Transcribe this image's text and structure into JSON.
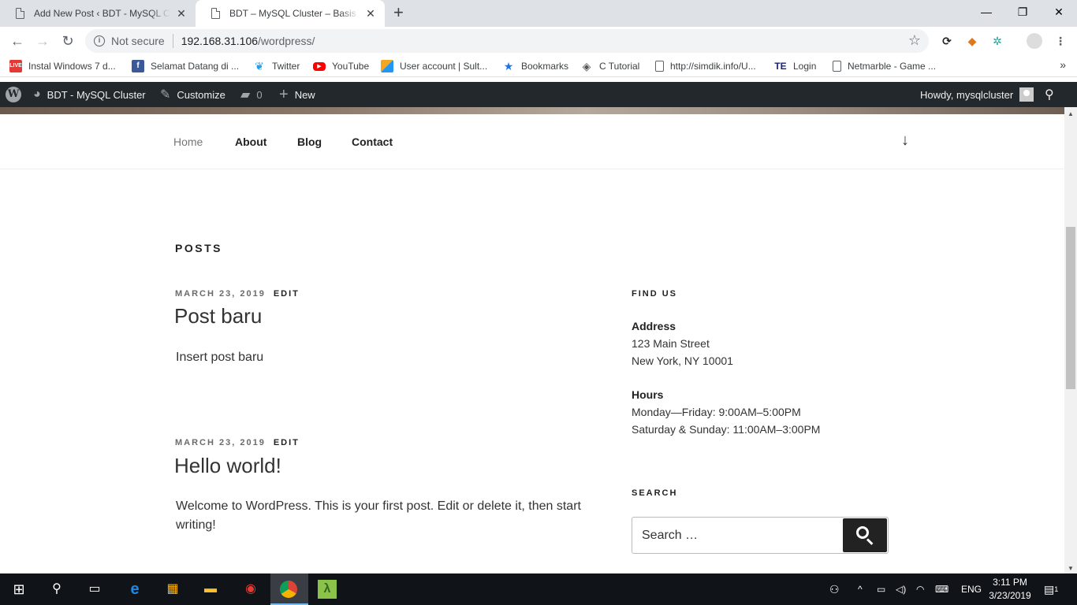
{
  "browser": {
    "tabs": [
      {
        "title": "Add New Post ‹ BDT - MySQL Cluster — WordPress",
        "close": "✕"
      },
      {
        "title": "BDT – MySQL Cluster – Basis Data Terdistribusi",
        "close": "✕"
      }
    ],
    "new_tab": "+",
    "window": {
      "minimize": "—",
      "maximize": "❐",
      "close": "✕"
    },
    "nav": {
      "back": "←",
      "forward": "→",
      "reload": "↻"
    },
    "security_label": "Not secure",
    "url_host": "192.168.31.106",
    "url_path": "/wordpress/",
    "bookmark_star": "☆",
    "bookmarks": [
      {
        "label": "Instal Windows 7 d...",
        "icon": "live-icon",
        "color": "#e53935"
      },
      {
        "label": "Selamat Datang di ...",
        "icon": "facebook-icon",
        "color": "#3b5998"
      },
      {
        "label": "Twitter",
        "icon": "twitter-icon",
        "color": "#1da1f2"
      },
      {
        "label": "YouTube",
        "icon": "youtube-icon",
        "color": "#ff0000"
      },
      {
        "label": "User account | Sult...",
        "icon": "sultan-icon",
        "color": "#f4a623"
      },
      {
        "label": "Bookmarks",
        "icon": "star-icon",
        "color": "#1a73e8"
      },
      {
        "label": "C Tutorial",
        "icon": "ctutorial-icon",
        "color": "#555555"
      },
      {
        "label": "http://simdik.info/U...",
        "icon": "doc-icon",
        "color": "#5f6368"
      },
      {
        "label": "Login",
        "icon": "te-icon",
        "color": "#1a237e"
      },
      {
        "label": "Netmarble - Game ...",
        "icon": "doc-icon",
        "color": "#5f6368"
      }
    ],
    "bookmarks_more": "»"
  },
  "adminbar": {
    "site_name": "BDT - MySQL Cluster",
    "customize": "Customize",
    "comments_count": "0",
    "new_label": "New",
    "howdy": "Howdy, mysqlcluster"
  },
  "nav": {
    "items": [
      "Home",
      "About",
      "Blog",
      "Contact"
    ],
    "scroll_arrow": "↓"
  },
  "main": {
    "section_title": "POSTS",
    "posts": [
      {
        "date": "MARCH 23, 2019",
        "edit": "EDIT",
        "title": "Post baru",
        "body": "Insert post baru"
      },
      {
        "date": "MARCH 23, 2019",
        "edit": "EDIT",
        "title": "Hello world!",
        "body": "Welcome to WordPress. This is your first post. Edit or delete it, then start writing!"
      }
    ]
  },
  "sidebar": {
    "find_us_title": "FIND US",
    "address_label": "Address",
    "address_line1": "123 Main Street",
    "address_line2": "New York, NY 10001",
    "hours_label": "Hours",
    "hours_line1": "Monday—Friday: 9:00AM–5:00PM",
    "hours_line2": "Saturday & Sunday: 11:00AM–3:00PM",
    "search_title": "SEARCH",
    "search_placeholder": "Search …"
  },
  "taskbar": {
    "language": "ENG",
    "time": "3:11 PM",
    "date": "3/23/2019",
    "notifications": "1"
  },
  "colors": {
    "adminbar": "#23282d",
    "taskbar": "#101418",
    "accent": "#76b9ed"
  }
}
